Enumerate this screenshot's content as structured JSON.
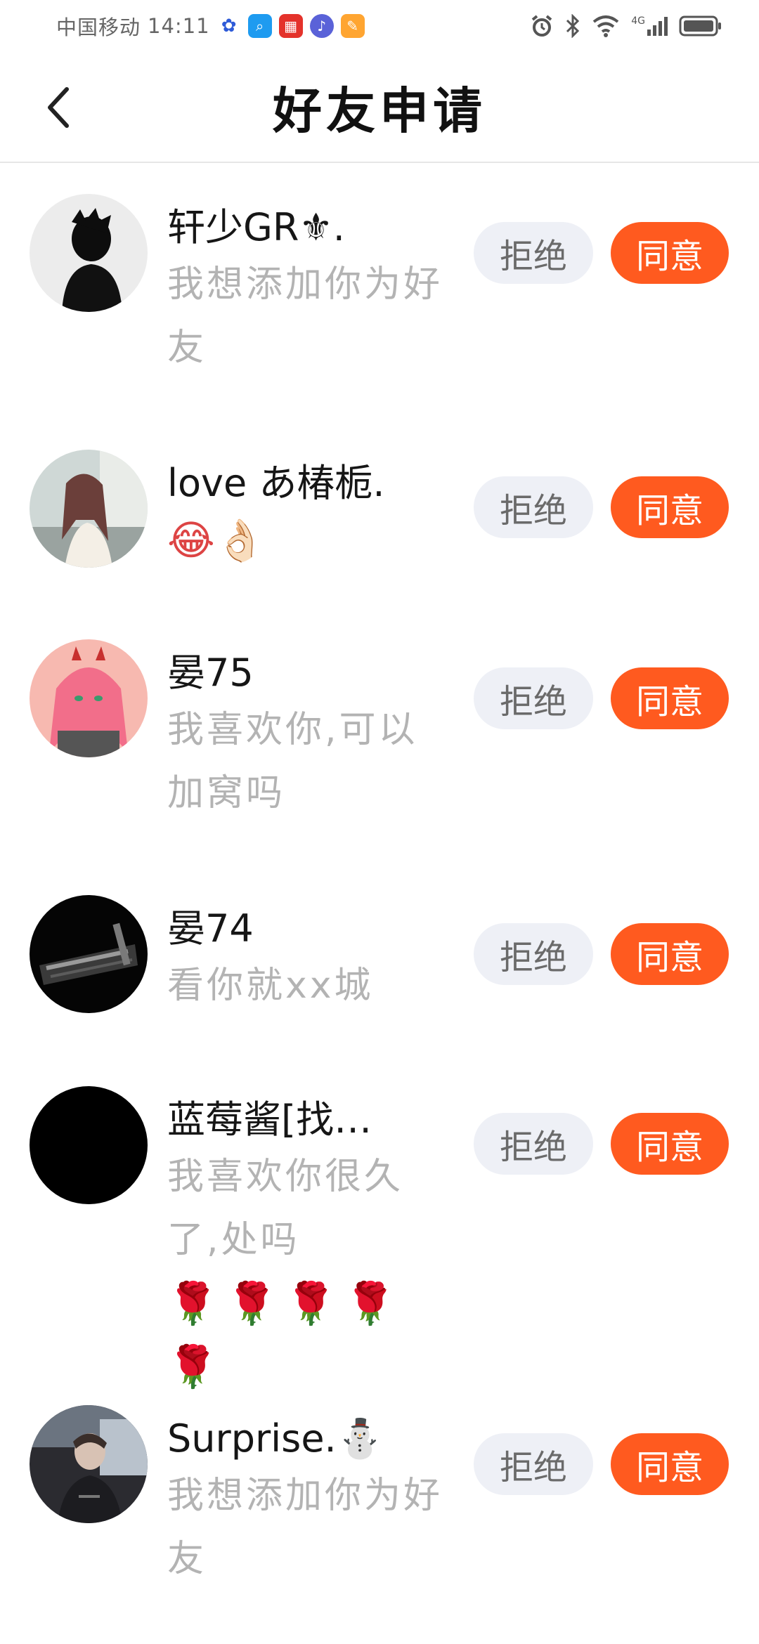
{
  "status_bar": {
    "carrier": "中国移动",
    "time": "14:11",
    "network": "4G"
  },
  "header": {
    "title": "好友申请"
  },
  "requests": [
    {
      "name": "轩少GR⚜.",
      "message": "我想添加你为好友",
      "reject_label": "拒绝",
      "accept_label": "同意"
    },
    {
      "name": "love あ椿栀.",
      "emojis": "😂👌🏻",
      "reject_label": "拒绝",
      "accept_label": "同意"
    },
    {
      "name": "晏75",
      "message": "我喜欢你,可以加窝吗",
      "reject_label": "拒绝",
      "accept_label": "同意"
    },
    {
      "name": "晏74",
      "message": "看你就xx城",
      "reject_label": "拒绝",
      "accept_label": "同意"
    },
    {
      "name": "蓝莓酱[找…",
      "message": "我喜欢你很久了,处吗",
      "emojis": "🌹🌹🌹🌹🌹",
      "reject_label": "拒绝",
      "accept_label": "同意"
    },
    {
      "name": "Surprise.⛄",
      "message": "我想添加你为好友",
      "reject_label": "拒绝",
      "accept_label": "同意"
    }
  ],
  "colors": {
    "accent": "#ff5a1f",
    "reject_bg": "#eef0f6",
    "message_text": "#b3b3b3"
  }
}
